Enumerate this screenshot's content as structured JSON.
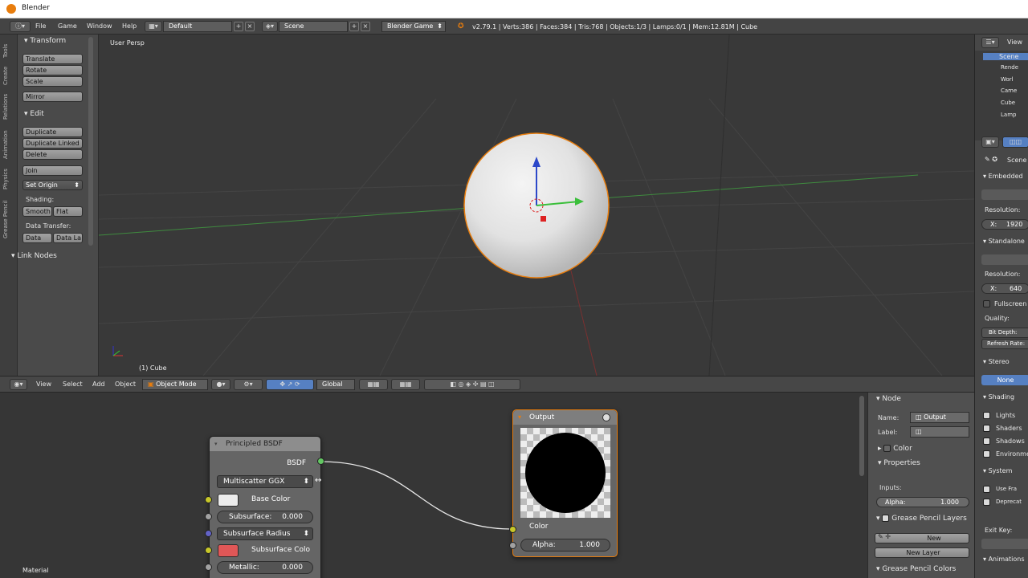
{
  "window": {
    "title": "Blender"
  },
  "topbar": {
    "menus": [
      "File",
      "Game",
      "Window",
      "Help"
    ],
    "layout": "Default",
    "scene": "Scene",
    "engine": "Blender Game",
    "stats": "v2.79.1 | Verts:386 | Faces:384 | Tris:768 | Objects:1/3 | Lamps:0/1 | Mem:12.81M | Cube"
  },
  "tools_panel": {
    "tabs": [
      "Tools",
      "Create",
      "Relations",
      "Animation",
      "Physics",
      "Grease Pencil"
    ],
    "transform_header": "Transform",
    "transform_buttons": [
      "Translate",
      "Rotate",
      "Scale"
    ],
    "mirror": "Mirror",
    "edit_header": "Edit",
    "edit_buttons": [
      "Duplicate",
      "Duplicate Linked",
      "Delete"
    ],
    "join": "Join",
    "set_origin": "Set Origin",
    "shading_label": "Shading:",
    "smooth": "Smooth",
    "flat": "Flat",
    "data_transfer_label": "Data Transfer:",
    "data": "Data",
    "data_layout": "Data La",
    "link_nodes": "Link Nodes"
  },
  "viewport": {
    "view_label": "User Persp",
    "object_label": "(1) Cube"
  },
  "viewport_header": {
    "menus": [
      "View",
      "Select",
      "Add",
      "Object"
    ],
    "mode": "Object Mode",
    "orientation": "Global"
  },
  "node_editor": {
    "bsdf_node": {
      "title": "Principled BSDF",
      "output": "BSDF",
      "distribution": "Multiscatter GGX",
      "base_color": "Base Color",
      "subsurface_label": "Subsurface:",
      "subsurface_value": "0.000",
      "subsurface_radius": "Subsurface Radius",
      "subsurface_color": "Subsurface Colo",
      "metallic_label": "Metallic:",
      "metallic_value": "0.000"
    },
    "output_node": {
      "title": "Output",
      "color": "Color",
      "alpha_label": "Alpha:",
      "alpha_value": "1.000"
    },
    "footer_label": "Material"
  },
  "node_props": {
    "node_header": "Node",
    "name_label": "Name:",
    "name_value": "Output",
    "label_label": "Label:",
    "color_section": "Color",
    "properties_section": "Properties",
    "inputs_label": "Inputs:",
    "alpha_label": "Alpha:",
    "alpha_value": "1.000",
    "grease_pencil_layers": "Grease Pencil Layers",
    "new_button": "New",
    "new_layer_button": "New Layer",
    "grease_pencil_colors": "Grease Pencil Colors"
  },
  "right_panel": {
    "outliner_view": "View",
    "outliner_items": [
      "Scene",
      "Rende",
      "Worl",
      "Came",
      "Cube",
      "Lamp"
    ],
    "scene_label": "Scene",
    "embedded": "Embedded",
    "resolution_label": "Resolution:",
    "res_x_label": "X:",
    "res_x_value": "1920",
    "standalone": "Standalone",
    "resolution2_label": "Resolution:",
    "res2_x_label": "X:",
    "res2_x_value": "640",
    "fullscreen": "Fullscreen",
    "quality": "Quality:",
    "bit_depth": "Bit Depth:",
    "refresh_rate": "Refresh Rate:",
    "stereo": "Stereo",
    "stereo_none": "None",
    "shading": "Shading",
    "lights": "Lights",
    "shaders": "Shaders",
    "shadows": "Shadows",
    "environment": "Environmen",
    "system": "System",
    "use_frame": "Use Fra",
    "deprecated": "Deprecat",
    "exit_key": "Exit Key:",
    "animations": "Animations"
  },
  "colors": {
    "accent": "#5680c2",
    "selection": "#e87d0d",
    "socket_yellow": "#c7c729",
    "socket_green": "#63c763",
    "socket_blue": "#6363c7",
    "subsurface_swatch": "#e05757"
  }
}
